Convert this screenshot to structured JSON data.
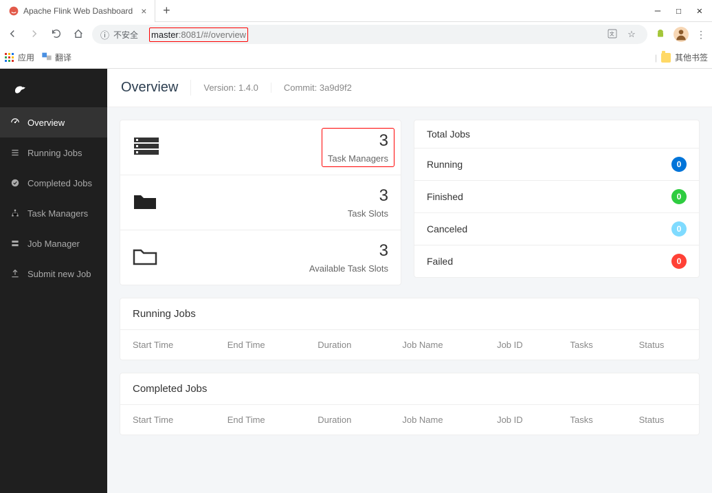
{
  "browser": {
    "tab_title": "Apache Flink Web Dashboard",
    "url_insecure_label": "不安全",
    "url_host": "master",
    "url_port": ":8081",
    "url_path": "/#/overview",
    "bookmarks": {
      "apps": "应用",
      "translate": "翻译",
      "other": "其他书签"
    }
  },
  "sidebar": {
    "items": [
      {
        "label": "Overview"
      },
      {
        "label": "Running Jobs"
      },
      {
        "label": "Completed Jobs"
      },
      {
        "label": "Task Managers"
      },
      {
        "label": "Job Manager"
      },
      {
        "label": "Submit new Job"
      }
    ]
  },
  "header": {
    "title": "Overview",
    "version": "Version: 1.4.0",
    "commit": "Commit: 3a9d9f2"
  },
  "stats": {
    "task_managers": {
      "count": "3",
      "label": "Task Managers"
    },
    "task_slots": {
      "count": "3",
      "label": "Task Slots"
    },
    "available_slots": {
      "count": "3",
      "label": "Available Task Slots"
    }
  },
  "jobs_summary": {
    "title": "Total Jobs",
    "rows": [
      {
        "name": "Running",
        "count": "0",
        "cls": "b-running"
      },
      {
        "name": "Finished",
        "count": "0",
        "cls": "b-finished"
      },
      {
        "name": "Canceled",
        "count": "0",
        "cls": "b-canceled"
      },
      {
        "name": "Failed",
        "count": "0",
        "cls": "b-failed"
      }
    ]
  },
  "running_panel": {
    "title": "Running Jobs"
  },
  "completed_panel": {
    "title": "Completed Jobs"
  },
  "columns": {
    "start": "Start Time",
    "end": "End Time",
    "duration": "Duration",
    "jobname": "Job Name",
    "jobid": "Job ID",
    "tasks": "Tasks",
    "status": "Status"
  }
}
